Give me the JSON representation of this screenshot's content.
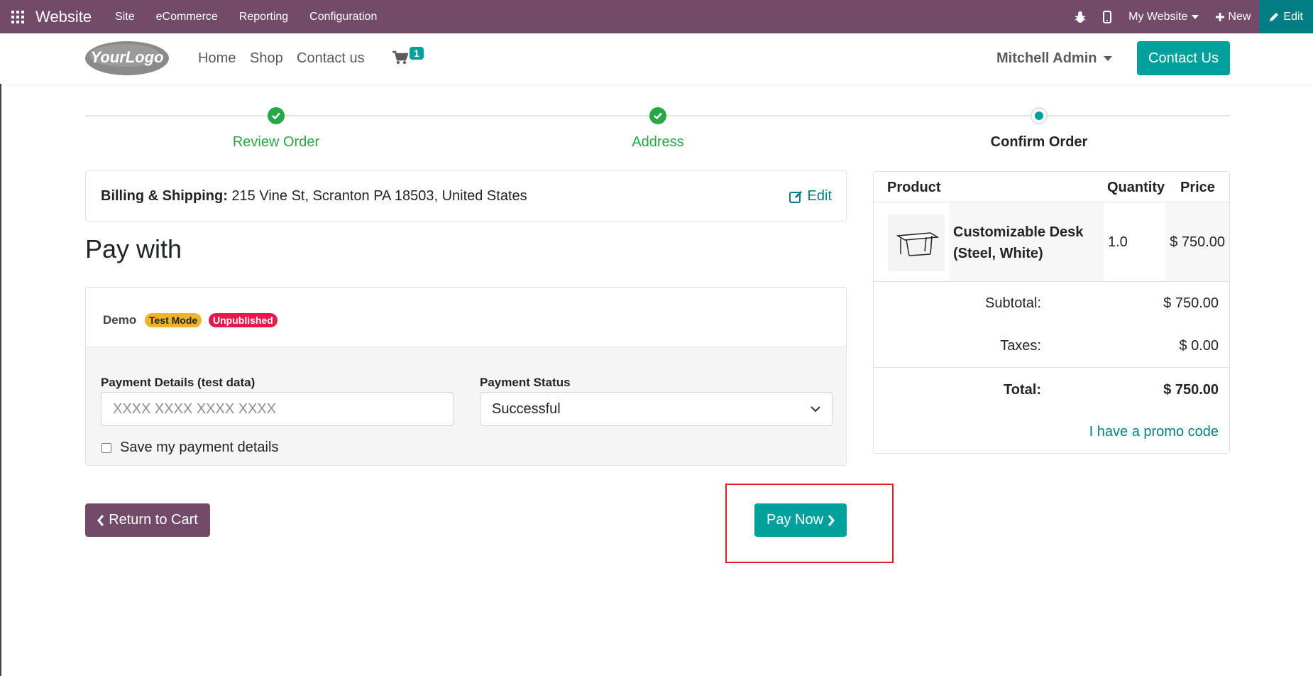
{
  "topbar": {
    "brand": "Website",
    "menu": [
      "Site",
      "eCommerce",
      "Reporting",
      "Configuration"
    ],
    "website_selector": "My Website",
    "new_label": "New",
    "edit_label": "Edit"
  },
  "header": {
    "logo_text": "YourLogo",
    "nav": [
      "Home",
      "Shop",
      "Contact us"
    ],
    "cart_count": "1",
    "user": "Mitchell Admin",
    "contact_button": "Contact Us"
  },
  "steps": [
    {
      "label": "Review Order",
      "state": "done"
    },
    {
      "label": "Address",
      "state": "done"
    },
    {
      "label": "Confirm Order",
      "state": "current"
    }
  ],
  "billing": {
    "label": "Billing & Shipping:",
    "address": "215 Vine St, Scranton PA 18503, United States",
    "edit_label": "Edit"
  },
  "payment": {
    "heading": "Pay with",
    "provider": "Demo",
    "badge_test": "Test Mode",
    "badge_unpublished": "Unpublished",
    "details_label": "Payment Details (test data)",
    "details_placeholder": "XXXX XXXX XXXX XXXX",
    "status_label": "Payment Status",
    "status_value": "Successful",
    "save_label": "Save my payment details"
  },
  "buttons": {
    "return": "Return to Cart",
    "pay_now": "Pay Now"
  },
  "summary": {
    "headers": [
      "Product",
      "Quantity",
      "Price"
    ],
    "product": {
      "name_line1": "Customizable Desk",
      "name_line2": "(Steel, White)",
      "quantity": "1.0",
      "price": "$ 750.00"
    },
    "subtotal_label": "Subtotal:",
    "subtotal": "$ 750.00",
    "taxes_label": "Taxes:",
    "taxes": "$ 0.00",
    "total_label": "Total:",
    "total": "$ 750.00",
    "promo": "I have a promo code"
  },
  "colors": {
    "odoo_purple": "#714b67",
    "teal": "#00a09d",
    "dark_teal": "#017e84",
    "success_green": "#28a745",
    "highlight_red": "#e31b23"
  }
}
